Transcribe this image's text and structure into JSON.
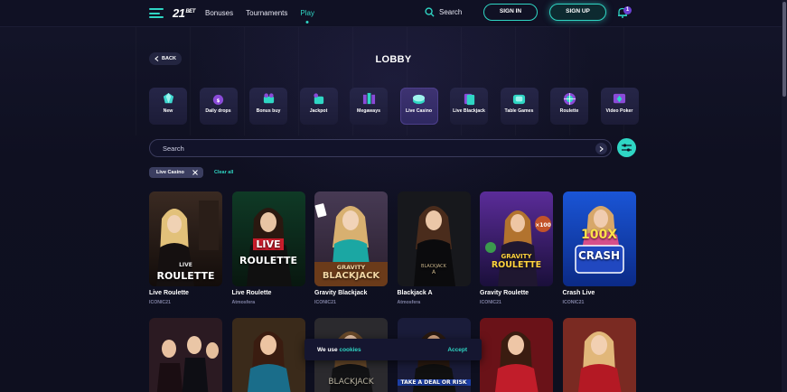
{
  "header": {
    "logo_main": "21",
    "logo_sub": "BET",
    "nav": [
      "Bonuses",
      "Tournaments",
      "Play"
    ],
    "active_nav": "Play",
    "search_label": "Search",
    "signin_label": "SIGN IN",
    "signup_label": "SIGN UP",
    "notification_count": "1"
  },
  "lobby": {
    "back_label": "BACK",
    "title": "LOBBY"
  },
  "categories": [
    {
      "label": "New",
      "icon": "gem-icon"
    },
    {
      "label": "Daily drops",
      "icon": "drops-icon"
    },
    {
      "label": "Bonus buy",
      "icon": "cart-icon"
    },
    {
      "label": "Jackpot",
      "icon": "jackpot-icon"
    },
    {
      "label": "Megaways",
      "icon": "megaways-icon"
    },
    {
      "label": "Live Casino",
      "icon": "chip-icon"
    },
    {
      "label": "Live Blackjack",
      "icon": "cards-icon"
    },
    {
      "label": "Table Games",
      "icon": "table-icon"
    },
    {
      "label": "Roulette",
      "icon": "roulette-icon"
    },
    {
      "label": "Video Poker",
      "icon": "poker-icon"
    }
  ],
  "search": {
    "placeholder": "Search"
  },
  "filters": {
    "active_chip": "Live Casino",
    "clear_label": "Clear all"
  },
  "games": [
    {
      "title": "Live Roulette",
      "provider": "ICONIC21",
      "thumb_text_top": "LIVE",
      "thumb_text_main": "ROULETTE"
    },
    {
      "title": "Live Roulette",
      "provider": "Atmosfera",
      "thumb_text_top": "LIVE",
      "thumb_text_main": "ROULETTE"
    },
    {
      "title": "Gravity Blackjack",
      "provider": "ICONIC21",
      "thumb_text_top": "GRAVITY",
      "thumb_text_main": "BLACKJACK"
    },
    {
      "title": "Blackjack A",
      "provider": "Atmosfera",
      "thumb_text_top": "BLACKJACK",
      "thumb_text_main": "A"
    },
    {
      "title": "Gravity Roulette",
      "provider": "ICONIC21",
      "thumb_text_top": "GRAVITY",
      "thumb_text_main": "ROULETTE"
    },
    {
      "title": "Crash Live",
      "provider": "ICONIC21",
      "thumb_text_top": "100X",
      "thumb_text_main": "CRASH"
    }
  ],
  "games_row2_thumb_text": [
    "",
    "",
    "BLACKJACK",
    "TAKE A DEAL OR RISK",
    "",
    ""
  ],
  "cookie": {
    "text_prefix": "We use",
    "link": "cookies",
    "accept": "Accept"
  },
  "colors": {
    "accent": "#2fd6c4",
    "background": "#0f1021",
    "card": "#1f1f3c"
  }
}
